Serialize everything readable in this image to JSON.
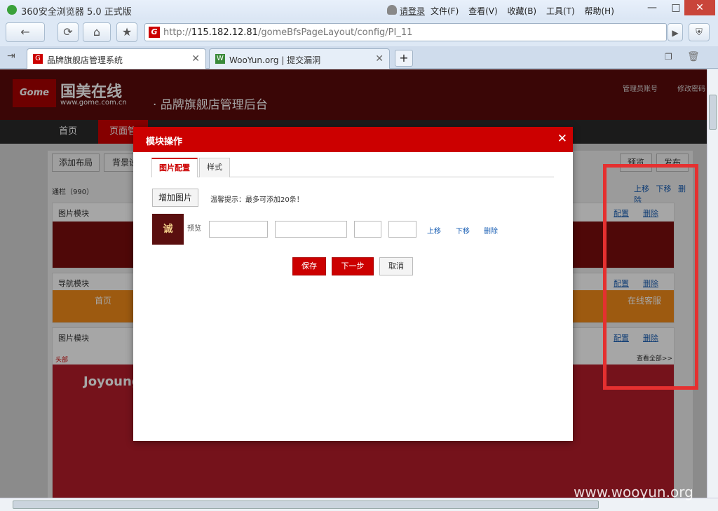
{
  "window": {
    "title": "360安全浏览器 5.0 正式版",
    "login": "请登录",
    "menu": [
      "文件(F)",
      "查看(V)",
      "收藏(B)",
      "工具(T)",
      "帮助(H)"
    ],
    "controls": {
      "minimize": "—",
      "maximize": "□",
      "close": "✕"
    }
  },
  "address": {
    "prefix": "http://",
    "host": "115.182.12.81",
    "path": "/gomeBfsPageLayout/config/PI_11"
  },
  "tabs": [
    {
      "label": "品牌旗舰店管理系统",
      "active": true
    },
    {
      "label": "WooYun.org | 提交漏洞",
      "active": false
    }
  ],
  "site": {
    "logo_text": "Gome",
    "brand": "国美在线",
    "url": "www.gome.com.cn",
    "system_name": "· 品牌旗舰店管理后台",
    "admin_account": "管理员账号",
    "change_password": "修改密码",
    "nav": [
      "首页",
      "页面管"
    ]
  },
  "page": {
    "toolbar": [
      "添加布局",
      "背景设",
      "预览",
      "发布"
    ],
    "section_label": "通栏（990）",
    "section_actions": [
      "上移",
      "下移",
      "删除"
    ],
    "modules": [
      {
        "title": "图片模块",
        "actions": [
          "配置",
          "删除"
        ]
      },
      {
        "title": "导航模块",
        "actions": [
          "配置",
          "删除"
        ]
      },
      {
        "title": "图片模块",
        "actions": [
          "配置",
          "删除"
        ]
      }
    ],
    "head_label": "头部",
    "view_all": "查看全部>>",
    "banner_text": "Joyoung",
    "nav_items": [
      "首页",
      "在线客服"
    ]
  },
  "dialog": {
    "title": "模块操作",
    "close": "✕",
    "tabs": [
      {
        "label": "图片配置",
        "active": true
      },
      {
        "label": "样式",
        "active": false
      }
    ],
    "add_image": "增加图片",
    "tip": "温馨提示：最多可添加20条！",
    "thumb_text": "诚",
    "preview": "预览",
    "row_actions": [
      "上移",
      "下移",
      "删除"
    ],
    "buttons": {
      "save": "保存",
      "next": "下一步",
      "cancel": "取消"
    }
  },
  "watermark": "www.wooyun.org",
  "colors": {
    "brand_red": "#cc0000",
    "header_dark": "#5a0a0a",
    "highlight": "#e53030",
    "link": "#1a5fb4"
  }
}
